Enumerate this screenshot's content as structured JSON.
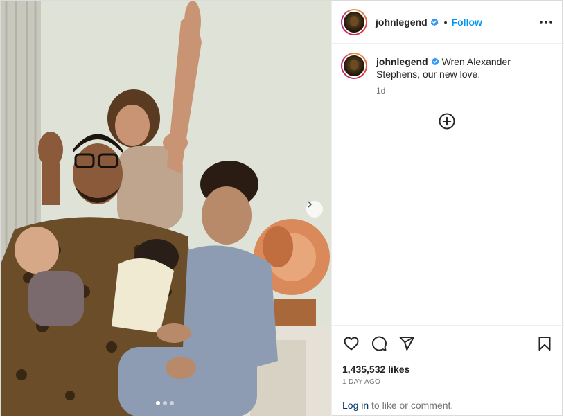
{
  "post": {
    "username": "johnlegend",
    "follow_label": "Follow",
    "bullet": "•",
    "caption_text": "Wren Alexander Stephens, our new love.",
    "caption_time": "1d",
    "likes": "1,435,532 likes",
    "posted_ago": "1 DAY AGO",
    "login_link": "Log in",
    "login_suffix": " to like or comment."
  },
  "carousel": {
    "total_slides": 3,
    "active_slide": 1
  },
  "colors": {
    "follow_blue": "#0095f6",
    "verified_blue": "#3897f0",
    "link_dark_blue": "#00376b"
  },
  "icons": {
    "header_more": "more-horizontal-icon",
    "next": "chevron-right-icon",
    "add_comment": "plus-circle-icon",
    "like": "heart-icon",
    "comment": "comment-bubble-icon",
    "share": "paper-plane-icon",
    "save": "bookmark-icon",
    "verified": "verified-badge-icon"
  }
}
